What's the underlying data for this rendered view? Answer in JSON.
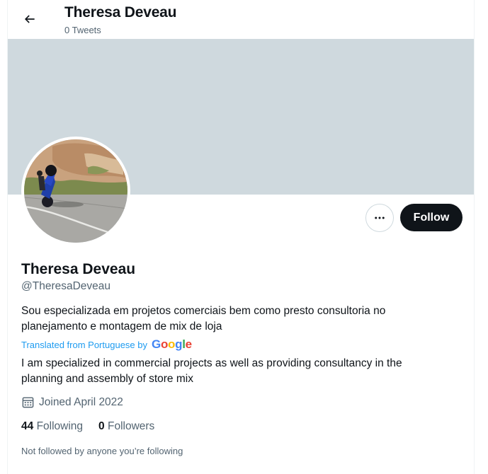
{
  "header": {
    "title": "Theresa Deveau",
    "subtitle": "0 Tweets"
  },
  "profile": {
    "display_name": "Theresa Deveau",
    "handle": "@TheresaDeveau",
    "bio_original": "Sou especializada em projetos comerciais bem como presto consultoria no planejamento e montagem de mix de loja",
    "translated_from": "Translated from Portuguese by",
    "translation_provider": "Google",
    "bio_translated": "I am specialized in commercial projects as well as providing consultancy in the planning and assembly of store mix",
    "joined": "Joined April 2022"
  },
  "actions": {
    "follow_label": "Follow",
    "more_icon": "more-icon"
  },
  "stats": {
    "following_count": "44",
    "following_label": "Following",
    "followers_count": "0",
    "followers_label": "Followers"
  },
  "footer_note": "Not followed by anyone you’re following",
  "colors": {
    "banner": "#cfd9de",
    "primary_text": "#0f1419",
    "secondary_text": "#536471",
    "link": "#1d9bf0",
    "follow_button_bg": "#0f1419"
  }
}
